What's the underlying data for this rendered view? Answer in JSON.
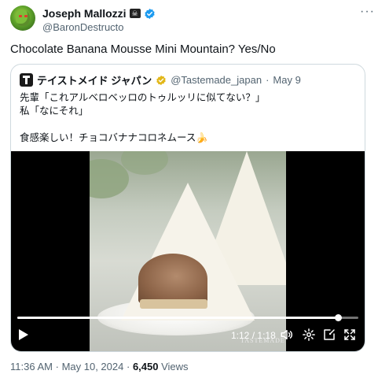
{
  "author": {
    "display_name": "Joseph Mallozzi",
    "flag_emoji": "🏴‍☠️",
    "handle": "@BaronDestructo",
    "more_label": "···"
  },
  "tweet": {
    "text": "Chocolate Banana Mousse Mini Mountain?  Yes/No"
  },
  "quoted": {
    "display_name": "テイストメイド ジャパン",
    "handle": "@Tastemade_japan",
    "separator": "·",
    "date": "May 9",
    "body": "先輩「これアルベロベッロのトゥルッリに似てない？」\n私「なにそれ」\n\n食感楽しい！チョコバナナコロネムース🍌"
  },
  "video": {
    "current_time": "1:12",
    "separator": "/",
    "duration": "1:18",
    "progress_fraction": 0.94,
    "watermark": "TASTEMADE"
  },
  "meta": {
    "time": "11:36 AM",
    "dot": "·",
    "date": "May 10, 2024",
    "views_count": "6,450",
    "views_label": "Views"
  },
  "colors": {
    "verified_blue": "#1d9bf0",
    "gold_badge": "#e2b719",
    "secondary_text": "#536471"
  }
}
